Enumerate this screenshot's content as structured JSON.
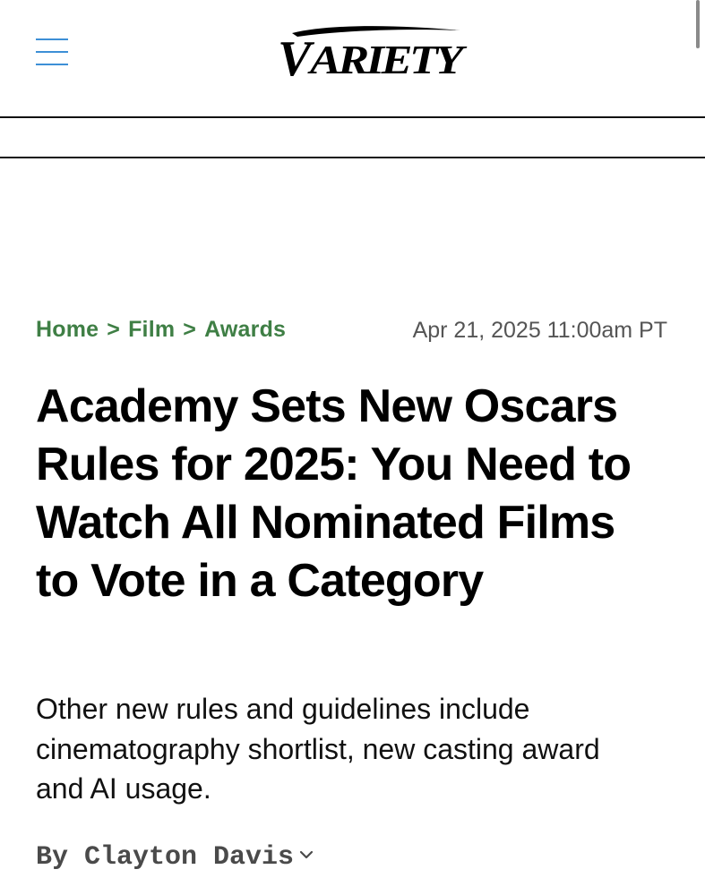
{
  "header": {
    "menu_icon": "hamburger-menu-icon",
    "logo_text": "VARIETY",
    "accent_color": "#3d8fd6"
  },
  "breadcrumb": {
    "items": [
      "Home",
      "Film",
      "Awards"
    ],
    "separator": ">",
    "color": "#3f7f45"
  },
  "article": {
    "timestamp": "Apr 21, 2025 11:00am PT",
    "headline": "Academy Sets New Oscars Rules for 2025: You Need to Watch All Nominated Films to Vote in a Category",
    "dek": "Other new rules and guidelines include cinematography shortlist, new casting award and AI usage.",
    "byline": "By Clayton Davis",
    "byline_icon": "chevron-down-icon"
  }
}
